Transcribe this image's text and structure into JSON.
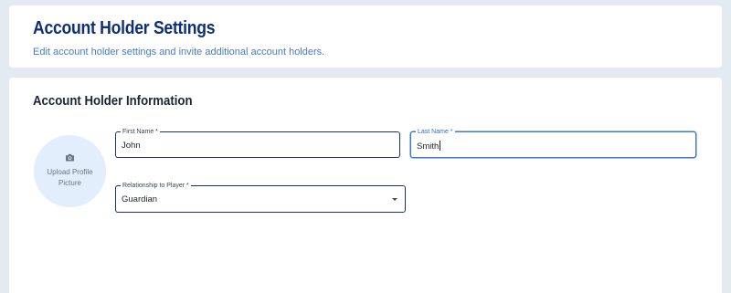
{
  "header": {
    "title": "Account Holder Settings",
    "subtitle": "Edit account holder settings and invite additional account holders."
  },
  "section": {
    "title": "Account Holder Information"
  },
  "avatar": {
    "icon": "camera-icon",
    "label_line1": "Upload Profile",
    "label_line2": "Picture"
  },
  "form": {
    "first_name": {
      "label": "First Name *",
      "value": "John"
    },
    "last_name": {
      "label": "Last Name *",
      "value": "Smith",
      "focused": true
    },
    "relationship": {
      "label": "Relationship to Player *",
      "value": "Guardian"
    }
  },
  "colors": {
    "background": "#e4eaf2",
    "title": "#0d2f7a",
    "subtitle": "#4b7bbd",
    "focus": "#3a7ac9",
    "avatar_bg": "#e2eefb"
  }
}
